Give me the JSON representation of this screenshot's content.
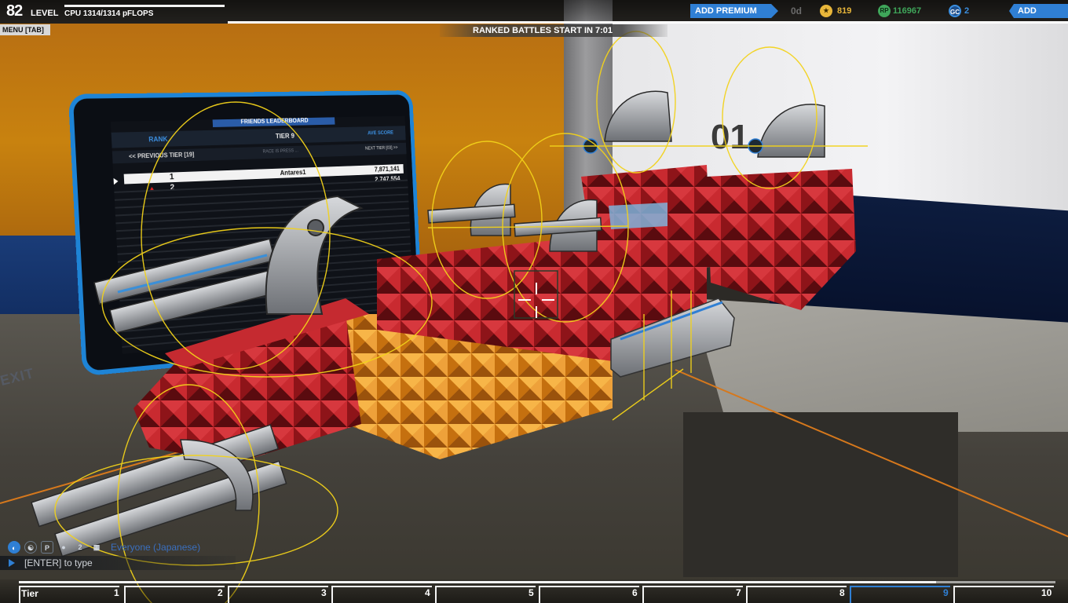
{
  "hud": {
    "level_number": "82",
    "level_label": "LEVEL",
    "cpu_text": "CPU  1314/1314 pFLOPS",
    "cpu_fraction": 1.0,
    "menu_label": "MENU [TAB]",
    "ranked_text": "RANKED BATTLES START IN 7:01",
    "add_premium_label": "ADD PREMIUM",
    "premium_days": "0d",
    "currencies": [
      {
        "icon": "tech-points-star-icon",
        "value": "819",
        "color": "#e8b63a"
      },
      {
        "icon": "robits-icon",
        "value": "116967",
        "color": "#3fa65a"
      },
      {
        "icon": "galaxy-coins-icon",
        "value": "2",
        "color": "#3b8fe0"
      }
    ],
    "add_funds_label": "ADD FUNDS"
  },
  "leaderboard": {
    "title": "FRIENDS LEADERBOARD",
    "rank_header": "RANK",
    "tier_header": "TIER 9",
    "score_header": "AVE SCORE",
    "prev_tier": "<< PREVIOUS TIER [19]",
    "race_hint": "RACE IS PRESS ...",
    "next_tier": "NEXT TIER [03] >>",
    "rows": [
      {
        "position": "1",
        "name": "Antares1",
        "score": "7,871,141"
      },
      {
        "position": "2",
        "name": "",
        "score": "2,747,554"
      }
    ],
    "exit_label": "EXIT"
  },
  "scene": {
    "wall_sign": "01"
  },
  "chat": {
    "tabs": [
      "all-chat-globe-icon",
      "clan-icon",
      "party-icon",
      "friends-icon",
      "group-icon"
    ],
    "channel": "Everyone (Japanese)",
    "placeholder": "[ENTER] to type"
  },
  "tier_bar": {
    "label": "Tier",
    "tiers": [
      "1",
      "2",
      "3",
      "4",
      "5",
      "6",
      "7",
      "8",
      "9",
      "10"
    ],
    "current": "9",
    "progress": 0.87
  },
  "colors": {
    "accent": "#2f7fd4",
    "robot_red": "#b81c22",
    "robot_orange": "#e8881a",
    "gizmo_yellow": "#f2d21a"
  }
}
